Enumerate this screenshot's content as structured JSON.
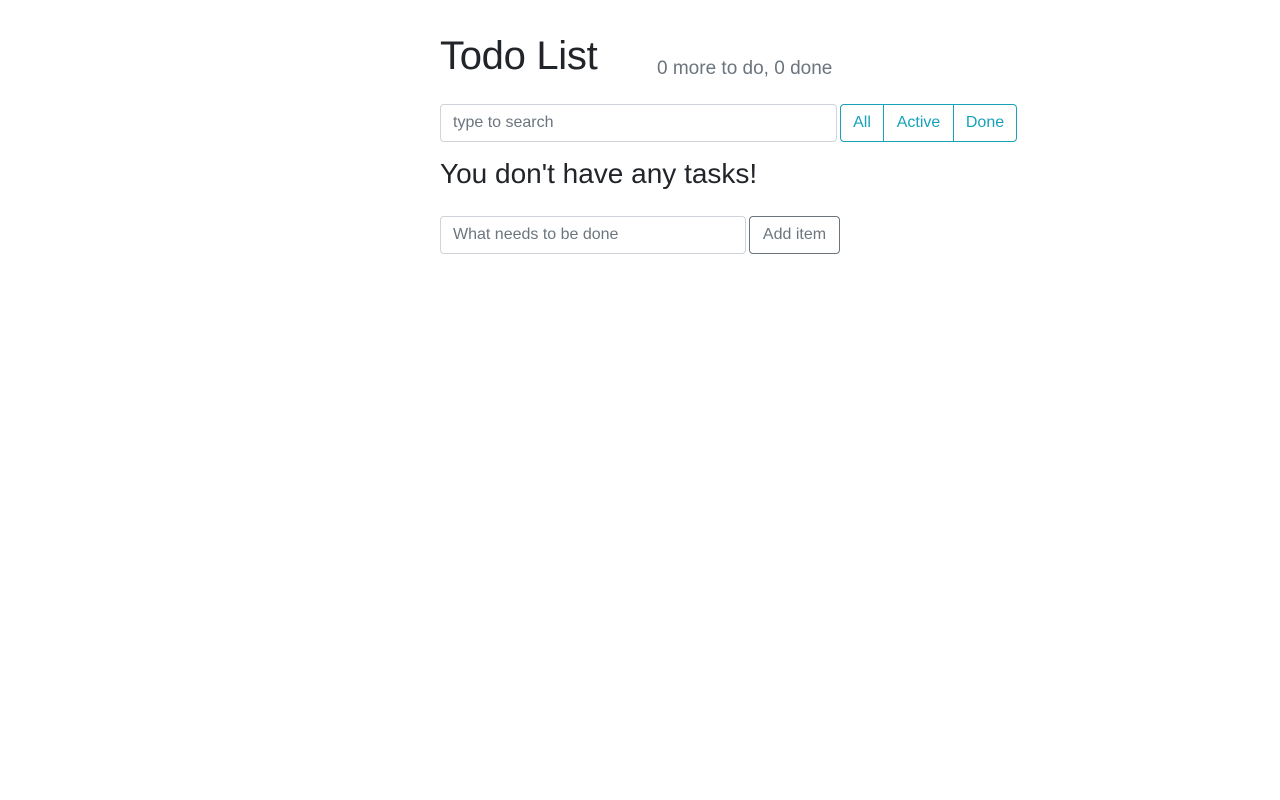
{
  "header": {
    "title": "Todo List",
    "counter": "0 more to do, 0 done"
  },
  "search": {
    "placeholder": "type to search",
    "value": ""
  },
  "filters": [
    {
      "label": "All"
    },
    {
      "label": "Active"
    },
    {
      "label": "Done"
    }
  ],
  "empty_message": "You don't have any tasks!",
  "add_item": {
    "placeholder": "What needs to be done",
    "value": "",
    "button_label": "Add item"
  },
  "colors": {
    "accent": "#17a2b8",
    "secondary": "#6c757d",
    "text": "#212529",
    "border": "#ced4da"
  }
}
